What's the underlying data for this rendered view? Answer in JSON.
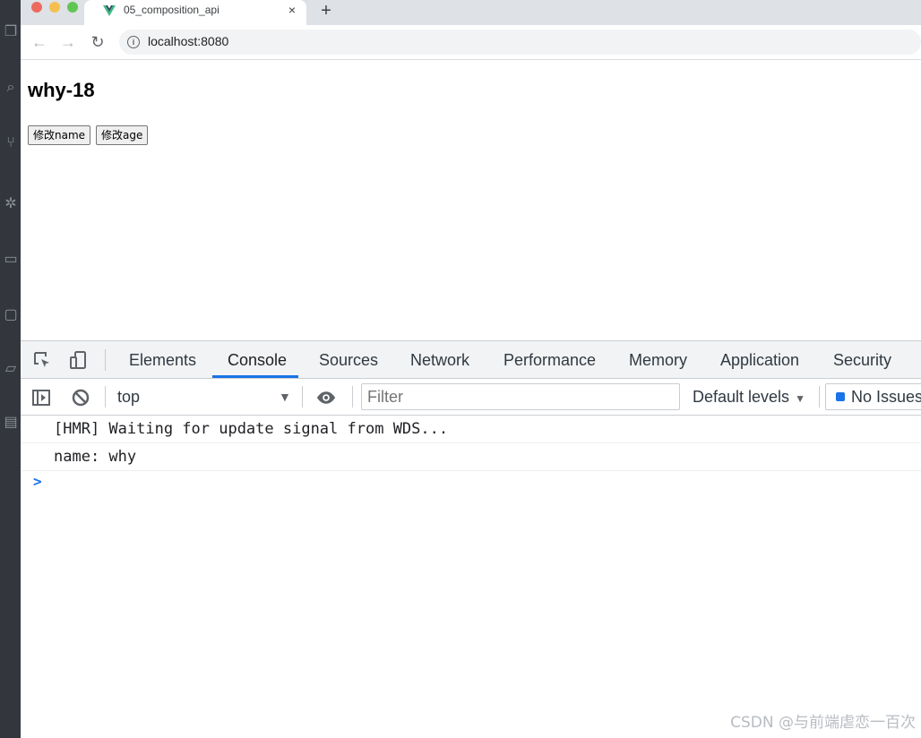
{
  "browser": {
    "tab_title": "05_composition_api",
    "tab_close": "×",
    "new_tab": "+",
    "url": "localhost:8080",
    "accent": "#1a73e8"
  },
  "page": {
    "heading": "why-18",
    "buttons": [
      "修改name",
      "修改age"
    ]
  },
  "devtools": {
    "tabs": [
      "Elements",
      "Console",
      "Sources",
      "Network",
      "Performance",
      "Memory",
      "Application",
      "Security"
    ],
    "active_tab": "Console",
    "context": "top",
    "filter_placeholder": "Filter",
    "levels": "Default levels",
    "issues": "No Issues",
    "messages": [
      "[HMR] Waiting for update signal from WDS...",
      "name: why"
    ],
    "prompt": ">"
  },
  "watermark": "CSDN @与前端虐恋一百次"
}
